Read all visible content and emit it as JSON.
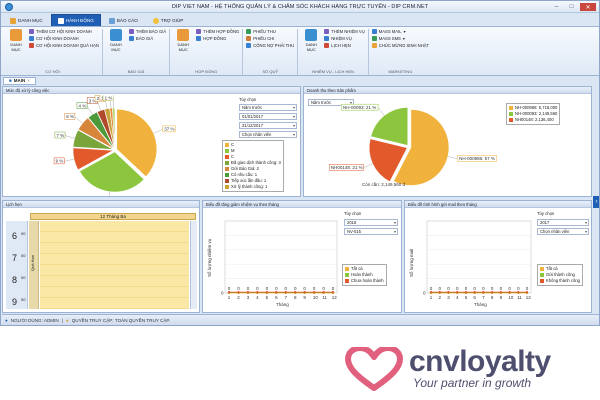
{
  "window": {
    "title": "DIP VIET NAM - HỆ THỐNG QUẢN LÝ & CHĂM SÓC KHÁCH HÀNG TRỰC TUYẾN - DIP CRM.NET"
  },
  "tabs": [
    {
      "label": "DANH MỤC"
    },
    {
      "label": "HÀNH ĐỘNG"
    },
    {
      "label": "BÁO CÁO"
    },
    {
      "label": "TRỢ GIÚP"
    }
  ],
  "ribbon": {
    "co_hoi": {
      "danh_muc": "DANH MỤC",
      "items": [
        "THÊM CƠ HỘI KINH DOANH",
        "CƠ HỘI KINH DOANH",
        "CƠ HỘI KINH DOANH QUÁ HẠN"
      ],
      "caption": "CƠ HỘI"
    },
    "bao_gia": {
      "danh_muc": "DANH MỤC",
      "items": [
        "THÊM BÁO GIÁ",
        "BÁO GIÁ"
      ],
      "caption": "BÁO GIÁ"
    },
    "hop_dong": {
      "danh_muc": "DANH MỤC",
      "items": [
        "THÊM HỢP ĐỒNG",
        "HỢP ĐỒNG"
      ],
      "caption": "HỢP ĐỒNG"
    },
    "so_quy": {
      "items": [
        "PHIẾU THU",
        "PHIẾU CHI",
        "CÔNG NỢ PHẢI THU"
      ],
      "caption": "SỔ QUỸ"
    },
    "nhiem_vu": {
      "danh_muc": "DANH MỤC",
      "items": [
        "THÊM NHIỆM VỤ",
        "NHIỆM VỤ",
        "LỊCH HẸN"
      ],
      "caption": "NHIỆM VỤ - LỊCH HẸN"
    },
    "marketing": {
      "items": [
        "MASS MAIL",
        "MASS SMS",
        "CHÚC MỪNG SINH NHẬT"
      ],
      "caption": "MARKETING"
    }
  },
  "main_tab": {
    "label": "MAIN",
    "close": "×"
  },
  "panel_task": {
    "title": "Mức độ xử lý công việc",
    "option_label": "Tùy chọn",
    "period": "Năm trước",
    "from": "01/01/2017",
    "to": "31/12/2017",
    "staff_placeholder": "Chọn nhân viên",
    "stats": [
      "Đã giao dịch thành công: 3",
      "Gửi Báo Giá: 2",
      "Có nhu cầu: 1",
      "Tiếp xúc lần đầu: 1",
      "Xử lý thành công: 1"
    ],
    "legend": [
      {
        "label": "C",
        "color": "#f0b23c"
      },
      {
        "label": "M",
        "color": "#8cc63e"
      },
      {
        "label": "C",
        "color": "#e2592c"
      },
      {
        "label": "Đã giao dịch thành công: 3",
        "color": "#7aa53a"
      },
      {
        "label": "Gửi Báo Giá: 2",
        "color": "#d6863a"
      },
      {
        "label": "Có nhu cầu: 1",
        "color": "#4e9a3a"
      },
      {
        "label": "Tiếp xúc lần đầu: 1",
        "color": "#b04a2a"
      },
      {
        "label": "Xử lý thành công: 1",
        "color": "#c9a23a"
      }
    ],
    "chart_data": {
      "type": "pie",
      "slices": [
        {
          "value": 37,
          "label": "37 %",
          "color": "#f0b23c"
        },
        {
          "value": 30,
          "label": "30 %",
          "color": "#8cc63e"
        },
        {
          "value": 9,
          "label": "9 %",
          "color": "#e2592c"
        },
        {
          "value": 7,
          "label": "7 %",
          "color": "#7aa53a"
        },
        {
          "value": 6,
          "label": "6 %",
          "color": "#d6863a"
        },
        {
          "value": 4,
          "label": "4 %",
          "color": "#4e9a3a"
        },
        {
          "value": 3,
          "label": "3 %",
          "color": "#b04a2a"
        },
        {
          "value": 2,
          "label": "2 %",
          "color": "#c9a23a"
        },
        {
          "value": 1,
          "label": "1 %",
          "color": "#e8873a"
        },
        {
          "value": 1,
          "label": "1 %",
          "color": "#b6d86a"
        }
      ]
    }
  },
  "panel_revenue": {
    "title": "Doanh thu theo Sản phẩm",
    "period": "Năm trước",
    "legend": [
      {
        "label": "NH-000986: 5,718,000",
        "color": "#f0b23c"
      },
      {
        "label": "NH-000093: 2,149,560",
        "color": "#8cc63e"
      },
      {
        "label": "NH00148: 2,136,400",
        "color": "#e2592c"
      }
    ],
    "chart_data": {
      "type": "pie",
      "slices": [
        {
          "value": 57,
          "label": "NH-000986: 57 %",
          "color": "#f0b23c"
        },
        {
          "value": 21,
          "label": "NH00148: 21 %",
          "color": "#e2592c"
        },
        {
          "value": 21,
          "label": "NH-00093: 21 %",
          "color": "#8cc63e"
        }
      ],
      "extra_label": "Còn cần: 2,149,560 đ"
    }
  },
  "panel_calendar": {
    "title": "Lịch hẹn",
    "date": "12 Tháng Ba",
    "row_label": "Quá Hạn",
    "hours": [
      "6",
      "7",
      "8",
      "9"
    ],
    "minutes": "00"
  },
  "panel_task_chart": {
    "title": "Biểu đồ tăng giảm nhiệm vụ theo tháng",
    "option_label": "Tùy chọn",
    "year": "2018",
    "staff": "NV-015",
    "legend": [
      {
        "label": "Tất cả",
        "color": "#f0b23c"
      },
      {
        "label": "Hoàn thành",
        "color": "#8cc63e"
      },
      {
        "label": "Chưa hoàn thành",
        "color": "#e2592c"
      }
    ],
    "chart_data": {
      "type": "line",
      "xlabel": "Tháng",
      "ylabel": "Số lượng nhiệm vụ",
      "x": [
        1,
        2,
        3,
        4,
        5,
        6,
        7,
        8,
        9,
        10,
        11,
        12
      ],
      "ylim": [
        0,
        1
      ],
      "series": [
        {
          "name": "Tất cả",
          "values": [
            0,
            0,
            0,
            0,
            0,
            0,
            0,
            0,
            0,
            0,
            0,
            0
          ]
        },
        {
          "name": "Hoàn thành",
          "values": [
            0,
            0,
            0,
            0,
            0,
            0,
            0,
            0,
            0,
            0,
            0,
            0
          ]
        },
        {
          "name": "Chưa hoàn thành",
          "values": [
            0,
            0,
            0,
            0,
            0,
            0,
            0,
            0,
            0,
            0,
            0,
            0
          ]
        }
      ]
    }
  },
  "panel_mail_chart": {
    "title": "Biểu đồ tình hình gửi mail theo tháng",
    "option_label": "Tùy chọn",
    "year": "2017",
    "staff_placeholder": "Chọn nhân viên",
    "legend": [
      {
        "label": "Tất cả",
        "color": "#f0b23c"
      },
      {
        "label": "Gửi thành công",
        "color": "#8cc63e"
      },
      {
        "label": "Không thành công",
        "color": "#e2592c"
      }
    ],
    "chart_data": {
      "type": "line",
      "xlabel": "Tháng",
      "ylabel": "Số lượng mail",
      "x": [
        1,
        2,
        3,
        4,
        5,
        6,
        7,
        8,
        9,
        10,
        11,
        12
      ],
      "ylim": [
        0,
        1
      ],
      "series": [
        {
          "name": "Tất cả",
          "values": [
            0,
            0,
            0,
            0,
            0,
            0,
            0,
            0,
            0,
            0,
            0,
            0
          ]
        },
        {
          "name": "Gửi thành công",
          "values": [
            0,
            0,
            0,
            0,
            0,
            0,
            0,
            0,
            0,
            0,
            0,
            0
          ]
        },
        {
          "name": "Không thành công",
          "values": [
            0,
            0,
            0,
            0,
            0,
            0,
            0,
            0,
            0,
            0,
            0,
            0
          ]
        }
      ]
    }
  },
  "statusbar": {
    "user": "NGƯỜI DÙNG: ADMIN",
    "access": "QUYỀN TRUY CẬP: TOÀN QUYỀN TRUY CẬP."
  },
  "logo": {
    "word": "cnvloyalty",
    "tagline": "Your partner in growth",
    "color": "#e0607e"
  }
}
